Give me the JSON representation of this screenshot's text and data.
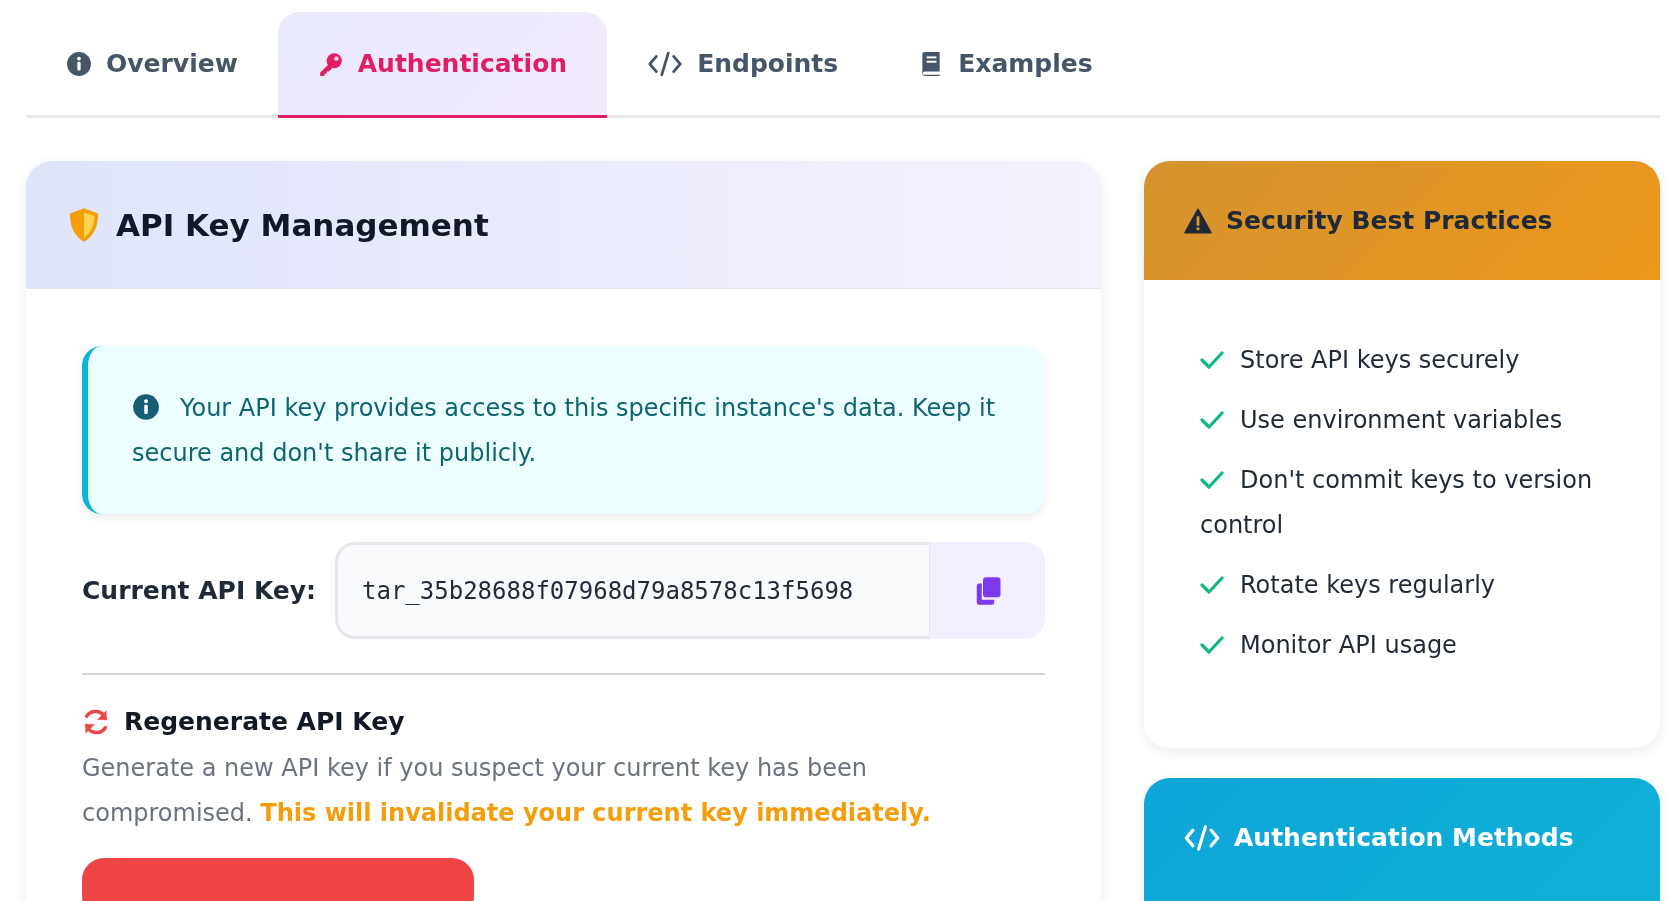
{
  "tabs": [
    {
      "label": "Overview",
      "selected": false
    },
    {
      "label": "Authentication",
      "selected": true
    },
    {
      "label": "Endpoints",
      "selected": false
    },
    {
      "label": "Examples",
      "selected": false
    }
  ],
  "key_card": {
    "title": "API Key Management",
    "alert": "Your API key provides access to this specific instance's data. Keep it secure and don't share it publicly.",
    "key_label": "Current API Key:",
    "key_value": "tar_35b28688f07968d79a8578c13f5698",
    "regenerate": {
      "title": "Regenerate API Key",
      "text": "Generate a new API key if you suspect your current key has been compromised.",
      "warning": "This will invalidate your current key immediately."
    }
  },
  "practices": {
    "title": "Security Best Practices",
    "items": [
      "Store API keys securely",
      "Use environment variables",
      "Don't commit keys to version control",
      "Rotate keys regularly",
      "Monitor API usage"
    ]
  },
  "methods": {
    "title": "Authentication Methods"
  }
}
